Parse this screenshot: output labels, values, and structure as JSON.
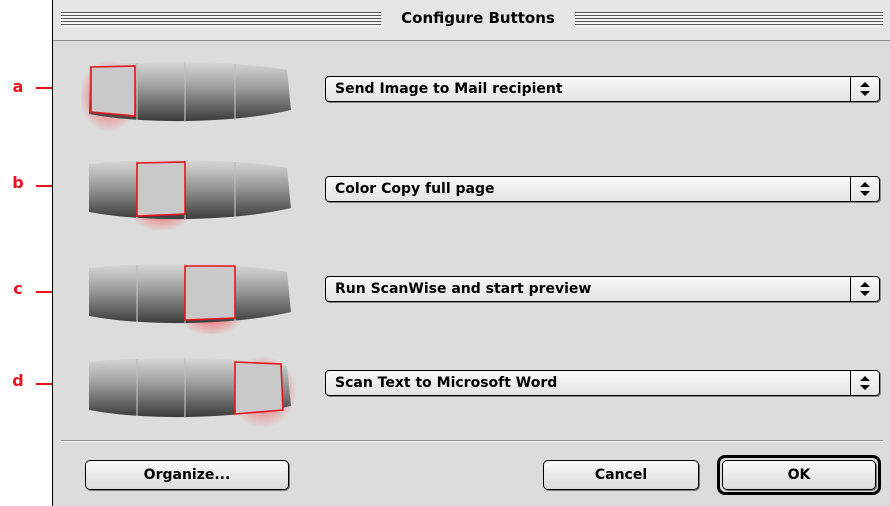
{
  "window": {
    "title": "Configure Buttons"
  },
  "callouts": [
    {
      "letter": "a"
    },
    {
      "letter": "b"
    },
    {
      "letter": "c"
    },
    {
      "letter": "d"
    }
  ],
  "buttons": [
    {
      "action": "Send Image to Mail recipient",
      "highlighted_segment": 1
    },
    {
      "action": "Color Copy full page",
      "highlighted_segment": 2
    },
    {
      "action": "Run ScanWise and start preview",
      "highlighted_segment": 3
    },
    {
      "action": "Scan Text to Microsoft Word",
      "highlighted_segment": 4
    }
  ],
  "footer": {
    "organize_label": "Organize...",
    "cancel_label": "Cancel",
    "ok_label": "OK"
  },
  "icons": {
    "popup_arrows": "up-down-arrows-icon",
    "scanner": "scanner-button-panel-icon"
  },
  "colors": {
    "callout": "#e8141c",
    "highlight_glow": "#ff3b3b",
    "dialog_bg": "#dcdcdc"
  }
}
